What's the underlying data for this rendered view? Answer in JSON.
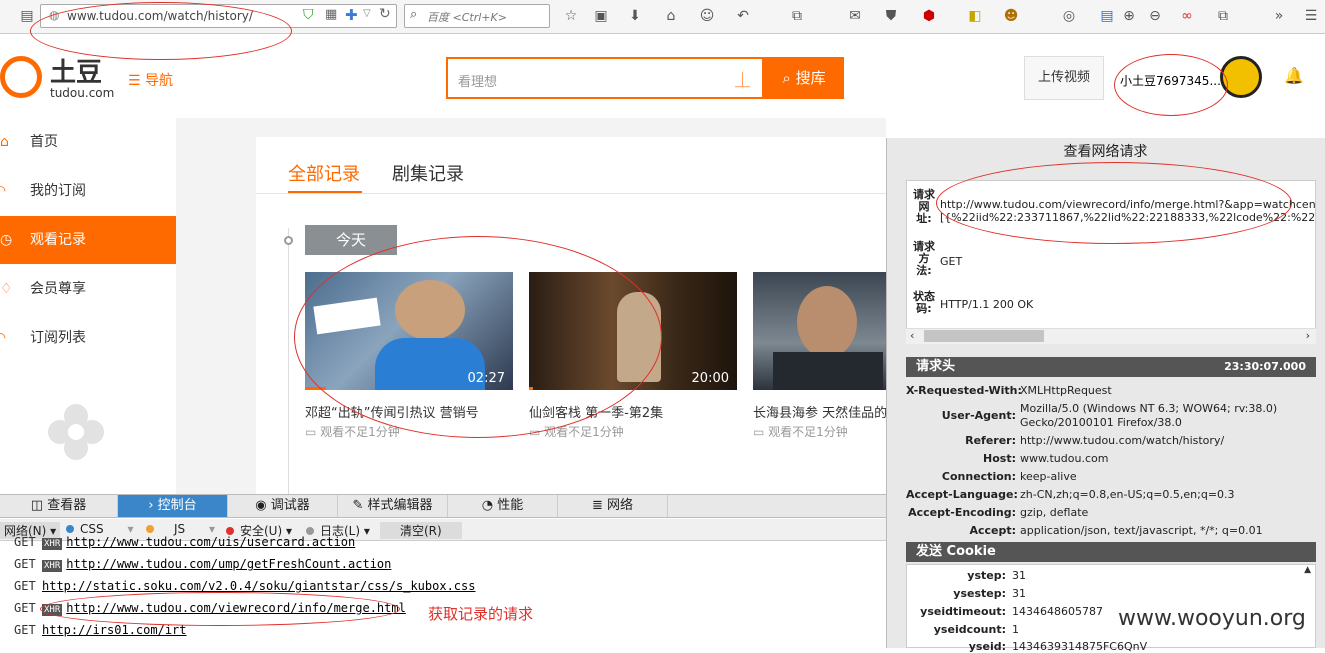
{
  "browser": {
    "url": "www.tudou.com/watch/history/",
    "search_placeholder": "百度 <Ctrl+K>"
  },
  "site": {
    "logo_cn": "土豆",
    "logo_en": "tudou.com",
    "nav_label": "☰ 导航",
    "search_placeholder": "看理想",
    "search_button": "搜库",
    "upload_button": "上传视频",
    "username": "小土豆7697345..."
  },
  "sidebar": {
    "items": [
      {
        "label": "首页",
        "icon": "home-icon"
      },
      {
        "label": "我的订阅",
        "icon": "rss-icon"
      },
      {
        "label": "观看记录",
        "icon": "clock-icon"
      },
      {
        "label": "会员尊享",
        "icon": "vip-icon"
      },
      {
        "label": "订阅列表",
        "icon": "rss-icon"
      }
    ]
  },
  "history": {
    "tabs": [
      "全部记录",
      "剧集记录"
    ],
    "date_label": "今天",
    "videos": [
      {
        "title": "邓超“出轨”传闻引热议 营销号",
        "duration": "02:27",
        "meta": "观看不足1分钟",
        "progress": 0.1
      },
      {
        "title": "仙剑客栈 第一季-第2集",
        "duration": "20:00",
        "meta": "观看不足1分钟",
        "progress": 0.02
      },
      {
        "title": "长海县海参 天然佳品的",
        "duration": "",
        "meta": "观看不足1分钟",
        "progress": 0.0
      }
    ]
  },
  "devtools": {
    "tabs": [
      "查看器",
      "控制台",
      "调试器",
      "样式编辑器",
      "性能",
      "网络"
    ],
    "filters": [
      "网络(N)",
      "CSS",
      "JS",
      "安全(U)",
      "日志(L)",
      "清空(R)"
    ],
    "console_rows": [
      {
        "method": "GET",
        "xhr": true,
        "url": "http://www.tudou.com/uis/usercard.action"
      },
      {
        "method": "GET",
        "xhr": true,
        "url": "http://www.tudou.com/ump/getFreshCount.action"
      },
      {
        "method": "GET",
        "xhr": false,
        "url": "http://static.soku.com/v2.0.4/soku/giantstar/css/s_kubox.css"
      },
      {
        "method": "GET",
        "xhr": true,
        "url": "http://www.tudou.com/viewrecord/info/merge.html"
      },
      {
        "method": "GET",
        "xhr": false,
        "url": "http://irs01.com/irt"
      }
    ],
    "annotation": "获取记录的请求"
  },
  "network_panel": {
    "title": "查看网络请求",
    "request_url_label": "请求网址:",
    "request_url_line1": "http://www.tudou.com/viewrecord/info/merge.html?&app=watchcenter&info=",
    "request_url_line2": "[{%22iid%22:233711867,%22lid%22:22188333,%22lcode%22:%22Q0MiBE2DI",
    "method_label": "请求方法:",
    "method": "GET",
    "status_label": "状态码:",
    "status": "HTTP/1.1 200 OK",
    "headers_title": "请求头",
    "headers_time": "23:30:07.000",
    "headers": [
      {
        "k": "X-Requested-With:",
        "v": "XMLHttpRequest"
      },
      {
        "k": "User-Agent:",
        "v": "Mozilla/5.0 (Windows NT 6.3; WOW64; rv:38.0)",
        "v2": "Gecko/20100101 Firefox/38.0"
      },
      {
        "k": "Referer:",
        "v": "http://www.tudou.com/watch/history/"
      },
      {
        "k": "Host:",
        "v": "www.tudou.com"
      },
      {
        "k": "Connection:",
        "v": "keep-alive"
      },
      {
        "k": "Accept-Language:",
        "v": "zh-CN,zh;q=0.8,en-US;q=0.5,en;q=0.3"
      },
      {
        "k": "Accept-Encoding:",
        "v": "gzip, deflate"
      },
      {
        "k": "Accept:",
        "v": "application/json, text/javascript, */*; q=0.01"
      }
    ],
    "cookie_title": "发送 Cookie",
    "cookies": [
      {
        "k": "ystep:",
        "v": "31"
      },
      {
        "k": "ysestep:",
        "v": "31"
      },
      {
        "k": "yseidtimeout:",
        "v": "1434648605787"
      },
      {
        "k": "yseidcount:",
        "v": "1"
      },
      {
        "k": "yseid:",
        "v": "1434639314875FC6QnV"
      }
    ]
  },
  "watermark": "www.wooyun.org",
  "colors": {
    "accent": "#ff6a00",
    "annotation": "#e0302a",
    "devtools_active": "#3a86c8"
  }
}
